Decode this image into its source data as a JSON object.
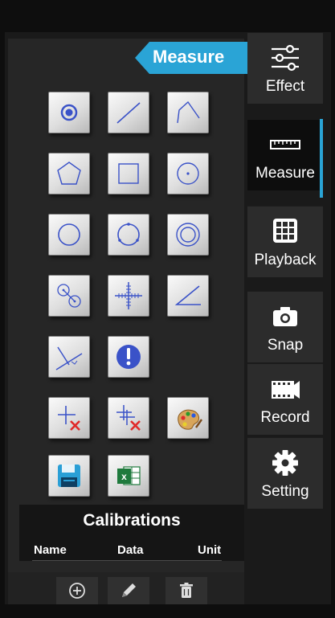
{
  "panel": {
    "title": "Measure"
  },
  "tools": [
    {
      "name": "point-tool-icon"
    },
    {
      "name": "line-tool-icon"
    },
    {
      "name": "polyline-tool-icon"
    },
    {
      "name": "polygon-tool-icon"
    },
    {
      "name": "rectangle-tool-icon"
    },
    {
      "name": "circle-center-tool-icon"
    },
    {
      "name": "circle-tool-icon"
    },
    {
      "name": "three-point-circle-tool-icon"
    },
    {
      "name": "concentric-circle-tool-icon"
    },
    {
      "name": "two-circle-distance-tool-icon"
    },
    {
      "name": "crosshair-tool-icon"
    },
    {
      "name": "angle-tool-icon"
    },
    {
      "name": "perpendicular-tool-icon"
    },
    {
      "name": "info-tool-icon"
    },
    {
      "name": "delete-mark-tool-icon"
    },
    {
      "name": "delete-all-marks-tool-icon"
    },
    {
      "name": "palette-tool-icon"
    },
    {
      "name": "save-tool-icon"
    },
    {
      "name": "excel-export-tool-icon"
    }
  ],
  "sidebar": {
    "tabs": [
      {
        "label": "Effect",
        "icon": "sliders-icon"
      },
      {
        "label": "Measure",
        "icon": "ruler-icon",
        "active": true
      },
      {
        "label": "Playback",
        "icon": "grid-icon"
      },
      {
        "label": "Snap",
        "icon": "camera-icon"
      },
      {
        "label": "Record",
        "icon": "film-icon"
      },
      {
        "label": "Setting",
        "icon": "gear-icon"
      }
    ]
  },
  "calibrations": {
    "title": "Calibrations",
    "columns": [
      "Name",
      "Data",
      "Unit"
    ]
  },
  "bottom_actions": [
    {
      "name": "add-icon"
    },
    {
      "name": "edit-icon"
    },
    {
      "name": "delete-icon"
    }
  ],
  "colors": {
    "accent": "#2aa4d6",
    "icon_blue": "#3a52c8"
  }
}
